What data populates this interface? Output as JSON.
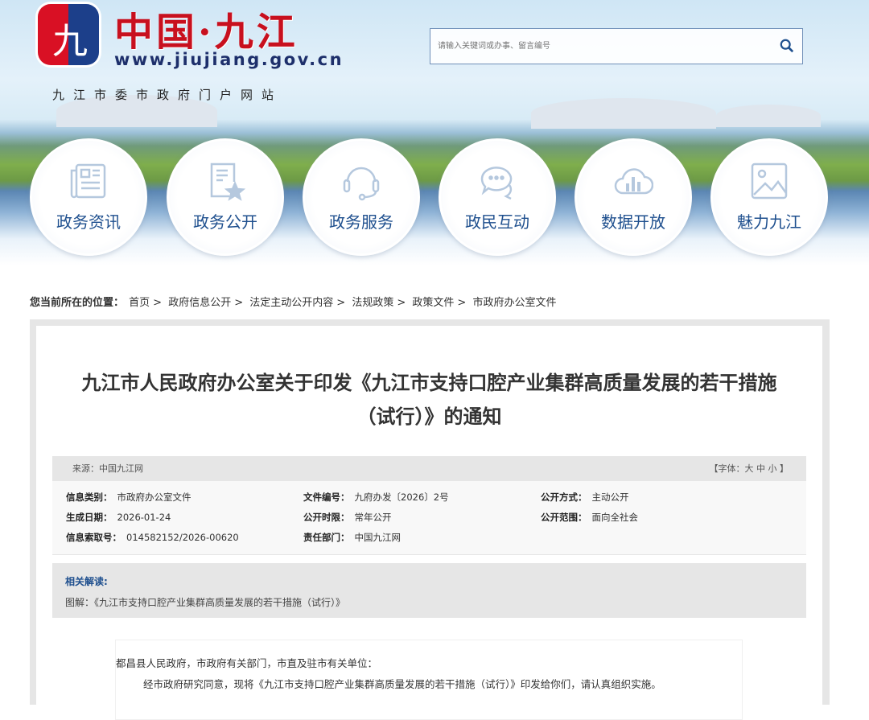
{
  "header": {
    "logo_char": "九",
    "site_title": "中国·九江",
    "url": "www.jiujiang.gov.cn",
    "subtitle": "九江市委市政府门户网站",
    "search_placeholder": "请输入关键词或办事、留言编号"
  },
  "nav": [
    {
      "label": "政务资讯",
      "icon": "newspaper-icon"
    },
    {
      "label": "政务公开",
      "icon": "document-star-icon"
    },
    {
      "label": "政务服务",
      "icon": "headset-icon"
    },
    {
      "label": "政民互动",
      "icon": "chat-icon"
    },
    {
      "label": "数据开放",
      "icon": "cloud-chart-icon"
    },
    {
      "label": "魅力九江",
      "icon": "image-icon"
    }
  ],
  "breadcrumb": {
    "label": "您当前所在的位置：",
    "items": [
      "首页",
      "政府信息公开",
      "法定主动公开内容",
      "法规政策",
      "政策文件",
      "市政府办公室文件"
    ],
    "sep": ">"
  },
  "article": {
    "title_line1": "九江市人民政府办公室关于印发《九江市支持口腔产业集群高质量发展的若干措施",
    "title_line2": "（试行）》的通知",
    "source": "来源：中国九江网",
    "font_label": "【字体：",
    "font_large": "大",
    "font_medium": "中",
    "font_small": "小",
    "font_end": "】",
    "info": {
      "category_label": "信息类别：",
      "category": "市政府办公室文件",
      "doc_no_label": "文件编号：",
      "doc_no": "九府办发〔2026〕2号",
      "method_label": "公开方式：",
      "method": "主动公开",
      "date_label": "生成日期：",
      "date": "2026-01-24",
      "limit_label": "公开时限：",
      "limit": "常年公开",
      "scope_label": "公开范围：",
      "scope": "面向全社会",
      "index_label": "信息索取号：",
      "index": "014582152/2026-00620",
      "dept_label": "责任部门：",
      "dept": "中国九江网"
    },
    "related_label": "相关解读:",
    "related_item": "图解：《九江市支持口腔产业集群高质量发展的若干措施（试行）》",
    "salutation": "都昌县人民政府，市政府有关部门，市直及驻市有关单位：",
    "para1": "经市政府研究同意，现将《九江市支持口腔产业集群高质量发展的若干措施（试行）》印发给你们，请认真组织实施。"
  }
}
